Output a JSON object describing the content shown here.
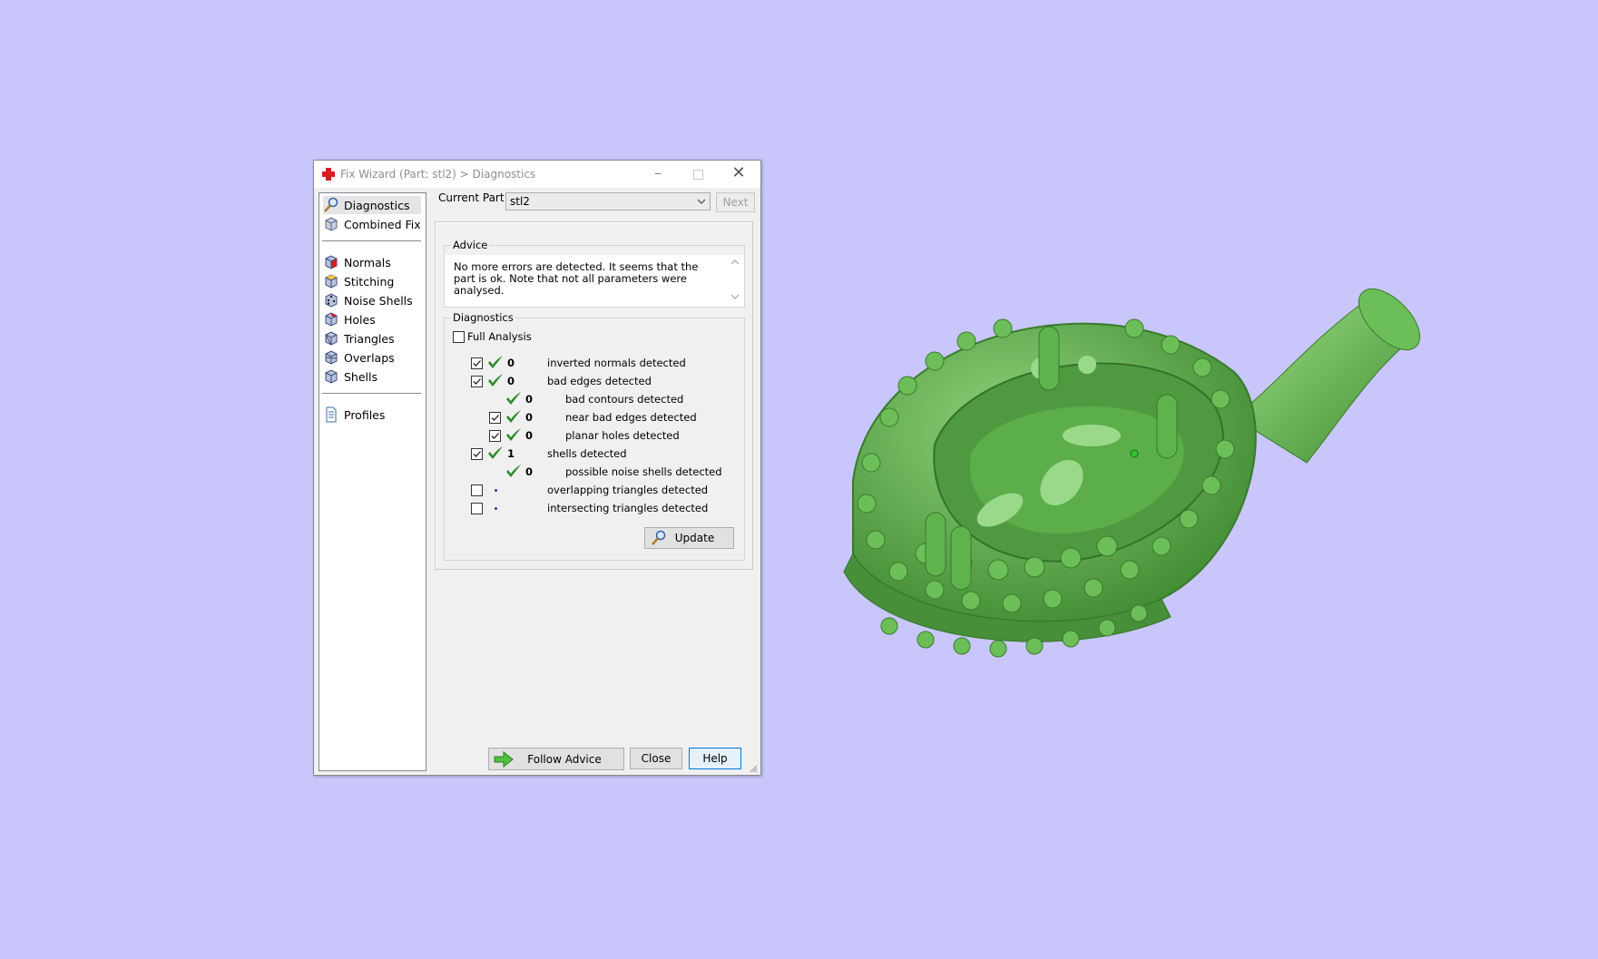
{
  "window": {
    "title": "Fix Wizard (Part: stl2) > Diagnostics"
  },
  "nav": {
    "items": [
      {
        "label": "Diagnostics",
        "icon": "magnifier-icon"
      },
      {
        "label": "Combined Fix",
        "icon": "cube-icon"
      },
      {
        "label": "Normals",
        "icon": "cube-red-face-icon"
      },
      {
        "label": "Stitching",
        "icon": "cube-yellow-face-icon"
      },
      {
        "label": "Noise Shells",
        "icon": "cube-dots-icon"
      },
      {
        "label": "Holes",
        "icon": "cube-red-corner-icon"
      },
      {
        "label": "Triangles",
        "icon": "cube-triangle-icon"
      },
      {
        "label": "Overlaps",
        "icon": "cube-overlap-icon"
      },
      {
        "label": "Shells",
        "icon": "cube-icon"
      },
      {
        "label": "Profiles",
        "icon": "document-icon"
      }
    ]
  },
  "part": {
    "label": "Current Part:",
    "value": "stl2",
    "next_label": "Next"
  },
  "advice": {
    "title": "Advice",
    "text": "No more errors are detected. It seems that the part is ok. Note that not all parameters were analysed."
  },
  "diagnostics": {
    "title": "Diagnostics",
    "full_analysis_label": "Full Analysis",
    "rows": [
      {
        "count": "0",
        "label": "inverted normals detected",
        "checked": true
      },
      {
        "count": "0",
        "label": "bad edges detected",
        "checked": true
      },
      {
        "count": "0",
        "label": "bad contours detected"
      },
      {
        "count": "0",
        "label": "near bad edges detected",
        "checked": true
      },
      {
        "count": "0",
        "label": "planar holes detected",
        "checked": true
      },
      {
        "count": "1",
        "label": "shells detected",
        "checked": true
      },
      {
        "count": "0",
        "label": "possible noise shells detected"
      },
      {
        "label": "overlapping triangles detected",
        "checked": false
      },
      {
        "label": "intersecting triangles detected",
        "checked": false
      }
    ],
    "update_label": "Update"
  },
  "footer": {
    "follow_label": "Follow Advice",
    "close_label": "Close",
    "help_label": "Help"
  },
  "colors": {
    "background": "#c8c6fb",
    "model": "#5aa848",
    "check": "#2e8b2e"
  }
}
